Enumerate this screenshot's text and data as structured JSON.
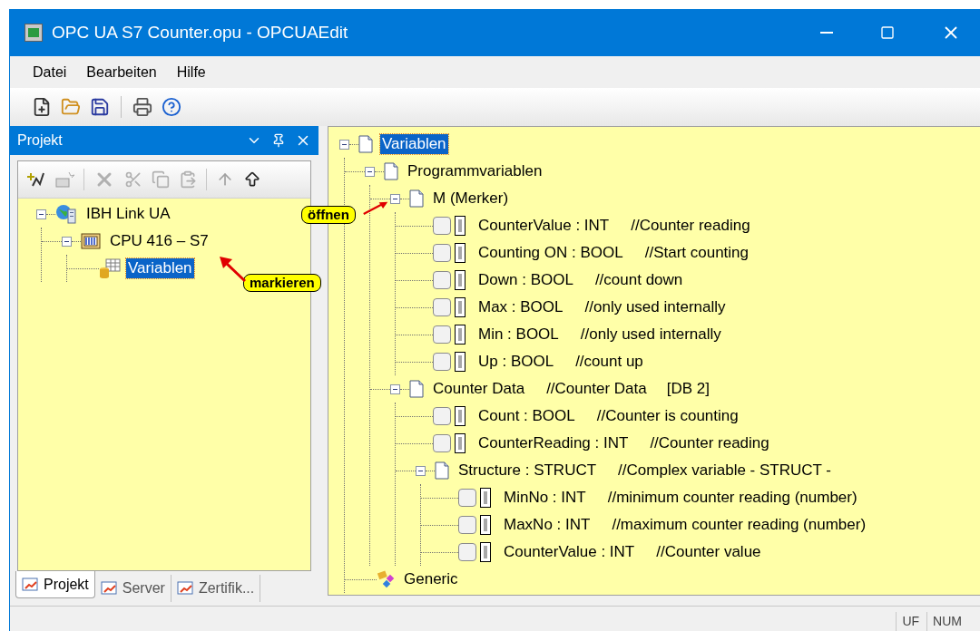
{
  "window": {
    "title": "OPC UA S7 Counter.opu - OPCUAEdit"
  },
  "menu": [
    "Datei",
    "Bearbeiten",
    "Hilfe"
  ],
  "project_panel": {
    "title": "Projekt",
    "tree": [
      {
        "kind": "server",
        "label": "IBH Link UA",
        "expanded": true,
        "selected": false,
        "children": [
          {
            "kind": "cpu",
            "label": "CPU 416 – S7",
            "expanded": true,
            "selected": false,
            "children": [
              {
                "kind": "table",
                "label": "Variablen",
                "selected": true
              }
            ]
          }
        ]
      }
    ],
    "tabs": [
      {
        "label": "Projekt",
        "selected": true
      },
      {
        "label": "Server",
        "selected": false
      },
      {
        "label": "Zertifik...",
        "selected": false
      }
    ]
  },
  "variable_tree": [
    {
      "kind": "folder",
      "label": "Variablen",
      "expanded": true,
      "selected": true,
      "children": [
        {
          "kind": "folder",
          "label": "Programmvariablen",
          "expanded": true,
          "selected": false,
          "children": [
            {
              "kind": "folder",
              "label": "M (Merker)",
              "expanded": true,
              "selected": false,
              "children": [
                {
                  "kind": "variable",
                  "label": "CounterValue : INT",
                  "comment": "//Counter reading",
                  "checked": false
                },
                {
                  "kind": "variable",
                  "label": "Counting ON : BOOL",
                  "comment": "//Start counting",
                  "checked": false
                },
                {
                  "kind": "variable",
                  "label": "Down : BOOL",
                  "comment": "//count down",
                  "checked": false
                },
                {
                  "kind": "variable",
                  "label": "Max : BOOL",
                  "comment": "//only used internally",
                  "checked": false
                },
                {
                  "kind": "variable",
                  "label": "Min : BOOL",
                  "comment": "//only used internally",
                  "checked": false
                },
                {
                  "kind": "variable",
                  "label": "Up : BOOL",
                  "comment": "//count up",
                  "checked": false
                }
              ]
            },
            {
              "kind": "folder",
              "label": "Counter Data",
              "comment": "//Counter Data",
              "suffix": "[DB 2]",
              "expanded": true,
              "selected": false,
              "children": [
                {
                  "kind": "variable",
                  "label": "Count : BOOL",
                  "comment": "//Counter is counting",
                  "checked": false
                },
                {
                  "kind": "variable",
                  "label": "CounterReading : INT",
                  "comment": "//Counter reading",
                  "checked": false
                },
                {
                  "kind": "folder",
                  "label": "Structure : STRUCT",
                  "comment": "//Complex variable - STRUCT -",
                  "expanded": true,
                  "selected": false,
                  "children": [
                    {
                      "kind": "variable",
                      "label": "MinNo : INT",
                      "comment": "//minimum counter reading (number)",
                      "checked": false
                    },
                    {
                      "kind": "variable",
                      "label": "MaxNo : INT",
                      "comment": "//maximum counter reading (number)",
                      "checked": false
                    },
                    {
                      "kind": "variable",
                      "label": "CounterValue : INT",
                      "comment": "//Counter value",
                      "checked": false
                    }
                  ]
                }
              ]
            }
          ]
        },
        {
          "kind": "generic",
          "label": "Generic",
          "selected": false
        }
      ]
    }
  ],
  "callouts": [
    "öffnen",
    "markieren"
  ],
  "status_bar": [
    "UF",
    "NUM"
  ]
}
